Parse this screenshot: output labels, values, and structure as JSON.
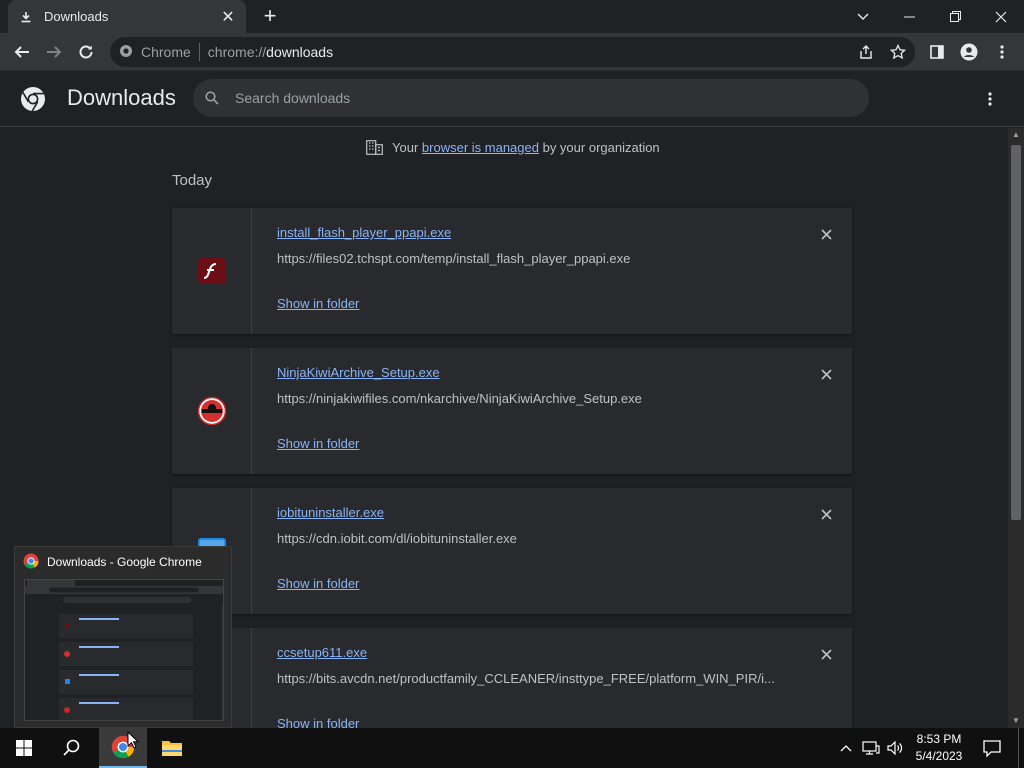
{
  "window": {
    "tab_title": "Downloads",
    "tab_icon": "download-icon",
    "colors": {
      "frame": "#202124",
      "toolbar": "#35363a",
      "link": "#8ab4f8",
      "card": "#292a2d"
    }
  },
  "omnibox": {
    "chip_label": "Chrome",
    "url_scheme": "chrome://",
    "url_host": "downloads"
  },
  "page": {
    "title": "Downloads",
    "search_placeholder": "Search downloads",
    "managed_prefix": "Your",
    "managed_link": "browser is managed",
    "managed_suffix": "by your organization",
    "section_label": "Today"
  },
  "downloads": [
    {
      "icon": "flash-player-icon",
      "filename": "install_flash_player_ppapi.exe",
      "url": "https://files02.tchspt.com/temp/install_flash_player_ppapi.exe",
      "action_label": "Show in folder"
    },
    {
      "icon": "ninjakiwi-icon",
      "filename": "NinjaKiwiArchive_Setup.exe",
      "url": "https://ninjakiwifiles.com/nkarchive/NinjaKiwiArchive_Setup.exe",
      "action_label": "Show in folder"
    },
    {
      "icon": "iobit-icon",
      "filename": "iobituninstaller.exe",
      "url": "https://cdn.iobit.com/dl/iobituninstaller.exe",
      "action_label": "Show in folder"
    },
    {
      "icon": "ccleaner-icon",
      "filename": "ccsetup611.exe",
      "url": "https://bits.avcdn.net/productfamily_CCLEANER/insttype_FREE/platform_WIN_PIR/i...",
      "action_label": "Show in folder"
    }
  ],
  "taskbar": {
    "preview_title": "Downloads - Google Chrome",
    "time": "8:53 PM",
    "date": "5/4/2023"
  }
}
